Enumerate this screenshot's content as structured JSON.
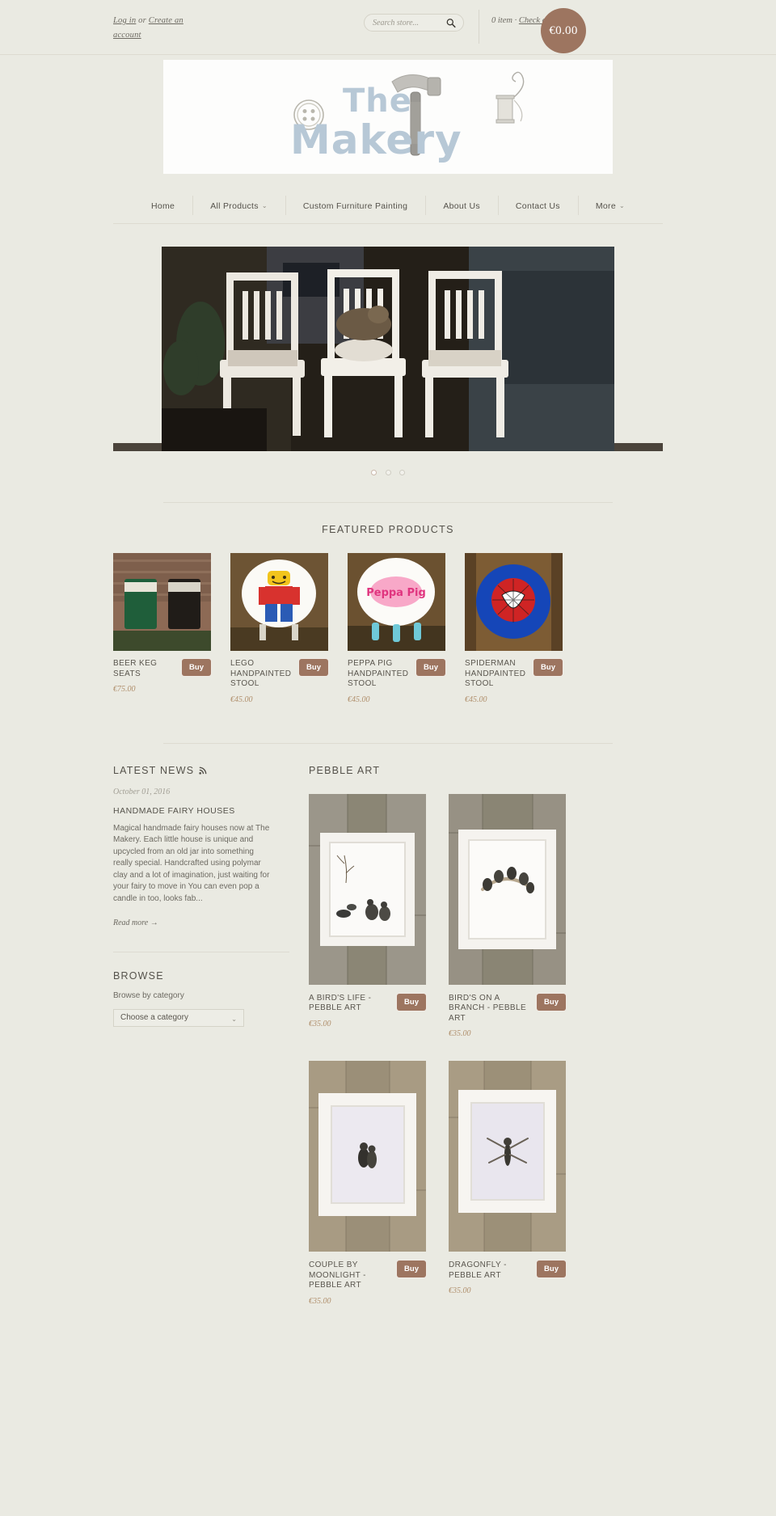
{
  "topbar": {
    "login_text": "Log in",
    "or_text": " or ",
    "create_account_text": "Create an account",
    "search_placeholder": "Search store...",
    "search_value": "",
    "search_icon": "search-icon",
    "cart_items": "0 item",
    "cart_separator": " · ",
    "checkout_text": "Check out",
    "cart_total": "€0.00",
    "cart_accent_color": "#9d7560"
  },
  "logo": {
    "line1": "The",
    "line2": "Makery",
    "button_icon": "button-icon",
    "hammer_icon": "hammer-icon",
    "thread-spool_icon": "thread-spool-icon"
  },
  "nav": {
    "items": [
      {
        "label": "Home",
        "caret": ""
      },
      {
        "label": "All Products",
        "caret": "⌄"
      },
      {
        "label": "Custom Furniture Painting",
        "caret": ""
      },
      {
        "label": "About Us",
        "caret": ""
      },
      {
        "label": "Contact Us",
        "caret": ""
      },
      {
        "label": "More",
        "caret": "⌄"
      }
    ]
  },
  "slider": {
    "alt": "Three white handpainted chairs with a cat",
    "dots": [
      "active",
      "plain",
      "plain"
    ]
  },
  "featured": {
    "title": "FEATURED PRODUCTS",
    "buy_label": "Buy",
    "products": [
      {
        "name": "BEER KEG SEATS",
        "price": "€75.00",
        "buy": "Buy"
      },
      {
        "name": "LEGO HANDPAINTED STOOL",
        "price": "€45.00",
        "buy": "Buy"
      },
      {
        "name": "PEPPA PIG HANDPAINTED STOOL",
        "price": "€45.00",
        "buy": "Buy"
      },
      {
        "name": "SPIDERMAN HANDPAINTED STOOL",
        "price": "€45.00",
        "buy": "Buy"
      }
    ]
  },
  "news": {
    "title": "LATEST NEWS",
    "rss_icon": "rss-icon",
    "date": "October 01, 2016",
    "headline": "HANDMADE FAIRY HOUSES",
    "body": "Magical handmade fairy houses now at The Makery. Each little house is unique and upcycled from an old jar into something really special. Handcrafted using polymar clay and a lot of imagination, just waiting for your fairy to move in  You can even pop a candle in too, looks fab...",
    "read_more": "Read more →"
  },
  "browse": {
    "title": "BROWSE",
    "label": "Browse by category",
    "select_value": "Choose a category",
    "select_caret": "⌄"
  },
  "pebble": {
    "title": "PEBBLE ART",
    "products": [
      {
        "name": "A BIRD'S LIFE - PEBBLE ART",
        "price": "€35.00",
        "buy": "Buy"
      },
      {
        "name": "BIRD'S ON A BRANCH - PEBBLE ART",
        "price": "€35.00",
        "buy": "Buy"
      },
      {
        "name": "COUPLE BY MOONLIGHT - PEBBLE ART",
        "price": "€35.00",
        "buy": "Buy"
      },
      {
        "name": "DRAGONFLY - PEBBLE ART",
        "price": "€35.00",
        "buy": "Buy"
      }
    ]
  }
}
